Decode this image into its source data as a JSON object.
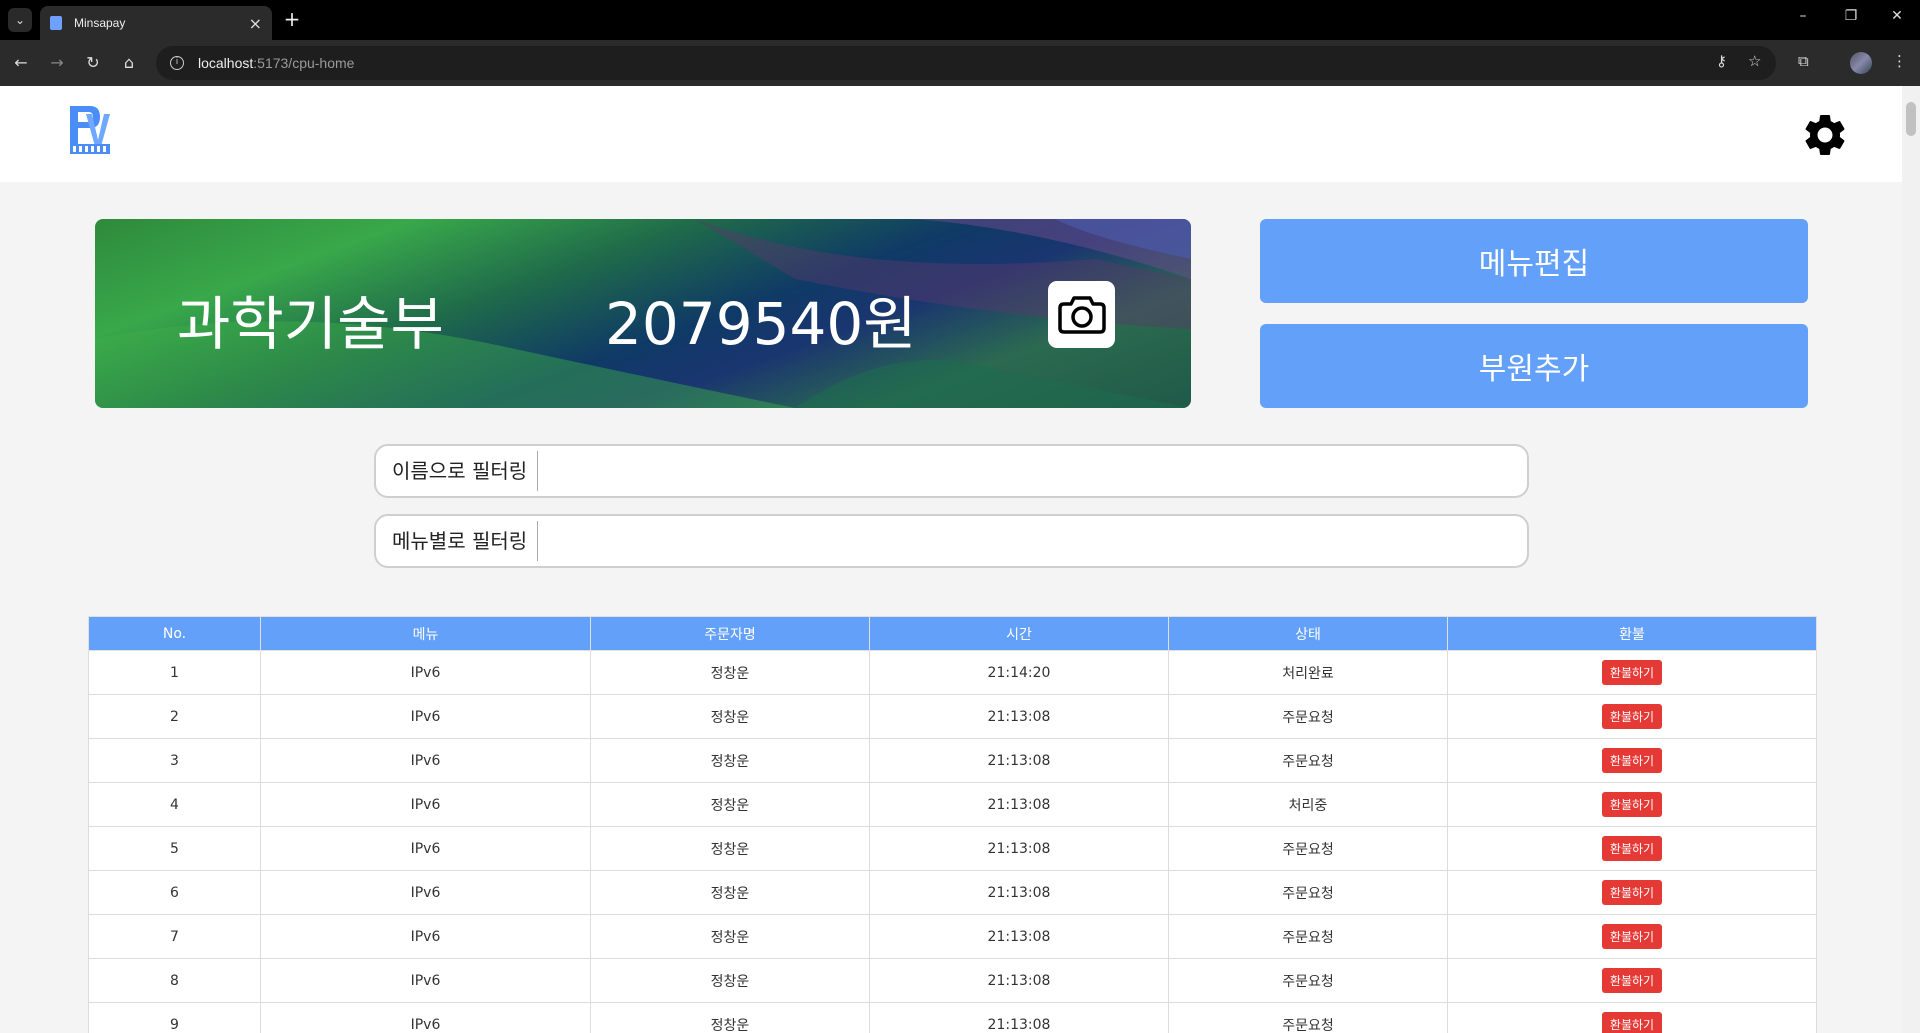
{
  "browser": {
    "tab_title": "Minsapay",
    "url_host": "localhost",
    "url_rest": ":5173/cpu-home"
  },
  "banner": {
    "dept_name": "과학기술부",
    "balance": "2079540원"
  },
  "actions": {
    "edit_menu_label": "메뉴편집",
    "add_member_label": "부원추가"
  },
  "filters": {
    "by_name_label": "이름으로 필터링",
    "by_name_value": "",
    "by_menu_label": "메뉴별로 필터링",
    "by_menu_value": ""
  },
  "table": {
    "headers": [
      "No.",
      "메뉴",
      "주문자명",
      "시간",
      "상태",
      "환불"
    ],
    "refund_label": "환불하기",
    "rows": [
      {
        "no": "1",
        "menu": "IPv6",
        "orderer": "정창운",
        "time": "21:14:20",
        "status": "처리완료"
      },
      {
        "no": "2",
        "menu": "IPv6",
        "orderer": "정창운",
        "time": "21:13:08",
        "status": "주문요청"
      },
      {
        "no": "3",
        "menu": "IPv6",
        "orderer": "정창운",
        "time": "21:13:08",
        "status": "주문요청"
      },
      {
        "no": "4",
        "menu": "IPv6",
        "orderer": "정창운",
        "time": "21:13:08",
        "status": "처리중"
      },
      {
        "no": "5",
        "menu": "IPv6",
        "orderer": "정창운",
        "time": "21:13:08",
        "status": "주문요청"
      },
      {
        "no": "6",
        "menu": "IPv6",
        "orderer": "정창운",
        "time": "21:13:08",
        "status": "주문요청"
      },
      {
        "no": "7",
        "menu": "IPv6",
        "orderer": "정창운",
        "time": "21:13:08",
        "status": "주문요청"
      },
      {
        "no": "8",
        "menu": "IPv6",
        "orderer": "정창운",
        "time": "21:13:08",
        "status": "주문요청"
      },
      {
        "no": "9",
        "menu": "IPv6",
        "orderer": "정창운",
        "time": "21:13:08",
        "status": "주문요청"
      }
    ]
  },
  "colors": {
    "accent": "#63a0f9",
    "refund": "#e53935"
  }
}
